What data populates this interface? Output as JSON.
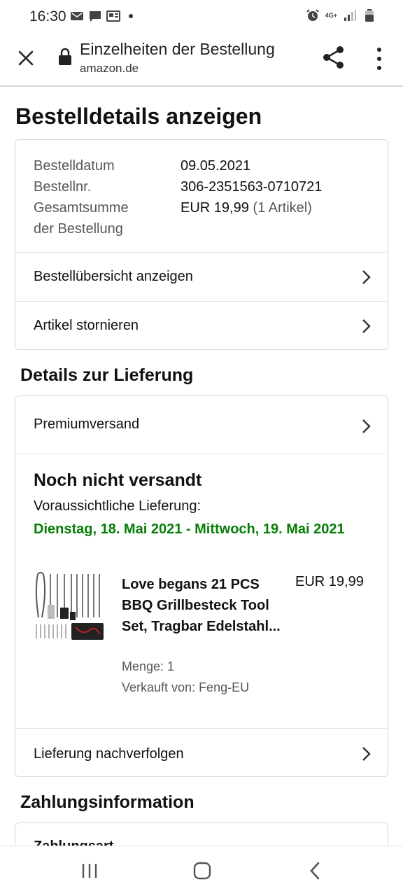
{
  "status_bar": {
    "time": "16:30",
    "network": "4G+"
  },
  "browser": {
    "page_title": "Einzelheiten der Bestellung",
    "domain": "amazon.de",
    "icons": [
      "close-icon",
      "lock-icon",
      "share-icon",
      "more-vertical-icon"
    ]
  },
  "page": {
    "heading": "Bestelldetails anzeigen"
  },
  "order_summary": {
    "date_label": "Bestelldatum",
    "date_value": "09.05.2021",
    "number_label": "Bestellnr.",
    "number_value": "306-2351563-0710721",
    "total_label": "Gesamtsumme der Bestellung",
    "total_value": "EUR 19,99",
    "total_items": "(1 Artikel)",
    "links": [
      {
        "label": "Bestellübersicht anzeigen"
      },
      {
        "label": "Artikel stornieren"
      }
    ]
  },
  "delivery": {
    "section_title": "Details zur Lieferung",
    "shipping_method": "Premiumversand",
    "status": "Noch nicht versandt",
    "eta_label": "Voraussichtliche Lieferung:",
    "eta_date": "Dienstag, 18. Mai 2021 - Mittwoch, 19. Mai 2021",
    "item": {
      "title": "Love begans 21 PCS BBQ Grillbesteck Tool Set, Tragbar Edelstahl...",
      "price": "EUR 19,99",
      "quantity": "Menge: 1",
      "seller": "Verkauft von: Feng-EU"
    },
    "track_link": "Lieferung nachverfolgen"
  },
  "payment": {
    "section_title": "Zahlungsinformation",
    "partial_label": "Zahlungsart"
  },
  "colors": {
    "accent_green": "#067d06",
    "border": "#d5d9d9",
    "muted_text": "#565959"
  }
}
